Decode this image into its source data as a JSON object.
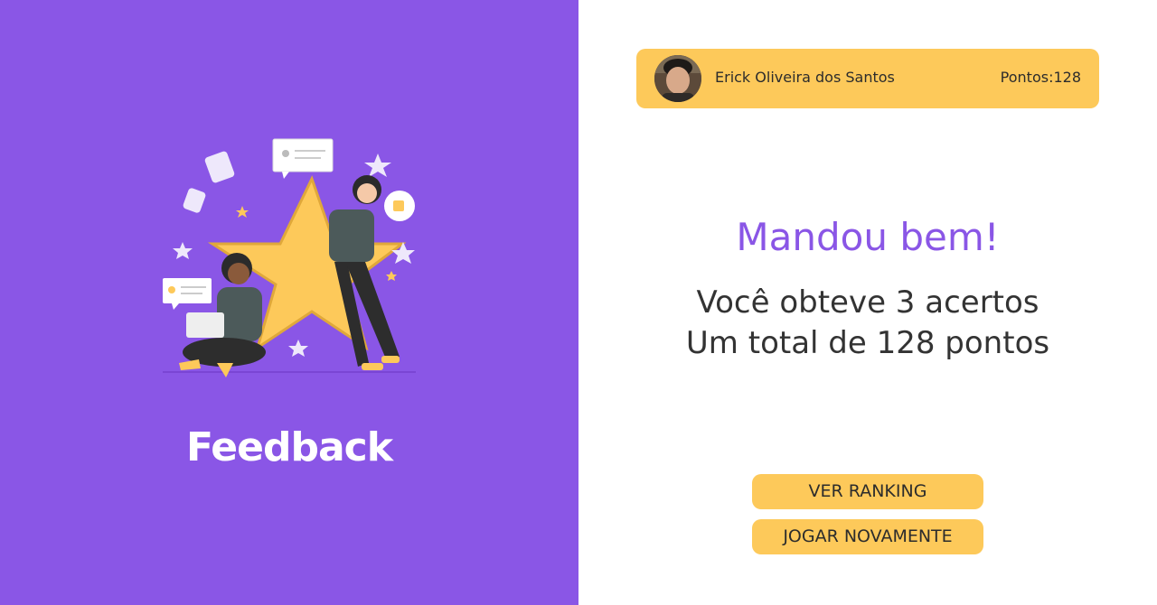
{
  "header": {
    "player_name": "Erick Oliveira dos Santos",
    "score_label": "Pontos:128"
  },
  "left": {
    "title": "Feedback",
    "illustration": "feedback-illustration-icon"
  },
  "main": {
    "message": "Mandou bem!",
    "result_hits": "Você obteve 3 acertos",
    "result_points": "Um total de 128 pontos"
  },
  "actions": {
    "ranking_label": "VER RANKING",
    "play_again_label": "JOGAR NOVAMENTE"
  },
  "colors": {
    "primary": "#8a56e6",
    "accent": "#fdc95a",
    "text": "#333333"
  }
}
